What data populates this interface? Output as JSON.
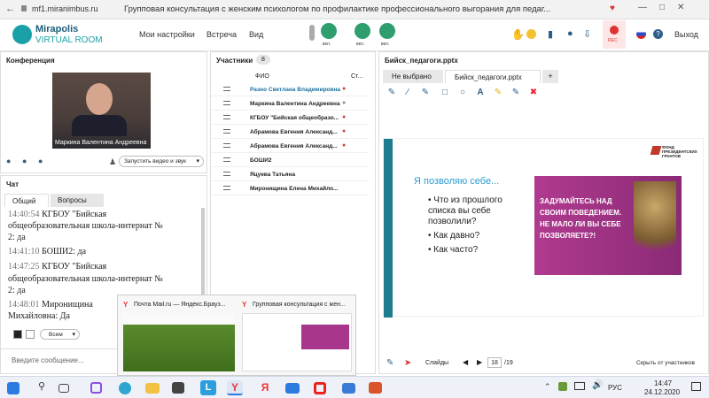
{
  "browser": {
    "url": "mf1.miranimbus.ru",
    "page_title": "Групповая консультация с женским психологом по профилактике профессионального выгорания для педаг..."
  },
  "app": {
    "logo_line1": "Mirapolis",
    "logo_line2": "VIRTUAL ROOM",
    "menu": [
      "Мои настройки",
      "Встреча",
      "Вид"
    ],
    "media_status": [
      "вкл.",
      "вкл.",
      "вкл."
    ],
    "rec_label": "REC",
    "exit_label": "Выход"
  },
  "conference": {
    "title": "Конференция",
    "speaker_name": "Маркина Валентина Андреевна",
    "start_button": "Запустить видео и звук"
  },
  "participants": {
    "title": "Участники",
    "count": "8",
    "col_name": "ФИО",
    "col_status": "Ст...",
    "rows": [
      "Разно Светлана Владимировна",
      "Маркина Валентина Андреевна",
      "КГБОУ \"Бийская общеобразо...",
      "Абрамова Евгения Александ...",
      "Абрамова Евгения Александ...",
      "БОШИ2",
      "Яцуева Татьяна",
      "Миронищина Елена Михайло..."
    ]
  },
  "chat": {
    "title": "Чат",
    "tabs": [
      "Общий",
      "Вопросы"
    ],
    "messages": [
      {
        "time": "14:40:54",
        "text": "КГБОУ \"Бийская"
      },
      {
        "time": "",
        "text": "общеобразовательная школа-интернат №"
      },
      {
        "time": "",
        "text": "2: да"
      },
      {
        "time": "14:41:10",
        "text": "БОШИ2: да"
      },
      {
        "time": "14:47:25",
        "text": "КГБОУ \"Бийская"
      },
      {
        "time": "",
        "text": "общеобразовательная школа-интернат №"
      },
      {
        "time": "",
        "text": "2: да"
      },
      {
        "time": "14:48:01",
        "text": "Миронищина"
      },
      {
        "time": "",
        "text": "Михайловна: Да"
      }
    ],
    "recipient": "Всем",
    "input_placeholder": "Введите сообщение..."
  },
  "presentation": {
    "file_title": "Бийск_педагоги.pptx",
    "tabs": [
      "Не выбрано",
      "Бийск_педагоги.pptx",
      "+"
    ],
    "slide_heading": "Я позволяю себе...",
    "bullets": [
      "Что из прошлого списка вы себе позволили?",
      "Как давно?",
      "Как часто?"
    ],
    "fund_label": "ФОНД ПРЕЗИДЕНТСКИХ ГРАНТОВ",
    "poster_text": "ЗАДУМАЙТЕСЬ НАД СВОИМ ПОВЕДЕНИЕМ. НЕ МАЛО ЛИ ВЫ СЕБЕ ПОЗВОЛЯЕТЕ?!",
    "slides_label": "Слайды",
    "current_slide": "18",
    "total_slides": "/19",
    "hide_label": "Скрыть от участников"
  },
  "taskbar_preview": {
    "items": [
      "Почта Mail.ru — Яндекс.Брауз...",
      "Групповая консультация с жен..."
    ]
  },
  "tray": {
    "lang": "РУС",
    "time": "14:47",
    "date": "24.12.2020"
  },
  "colors": {
    "accent_green": "#2e9e6e",
    "teal_logo": "#1aa1a8",
    "slide_teal": "#1f7c8f",
    "poster_magenta": "#a8368c"
  }
}
